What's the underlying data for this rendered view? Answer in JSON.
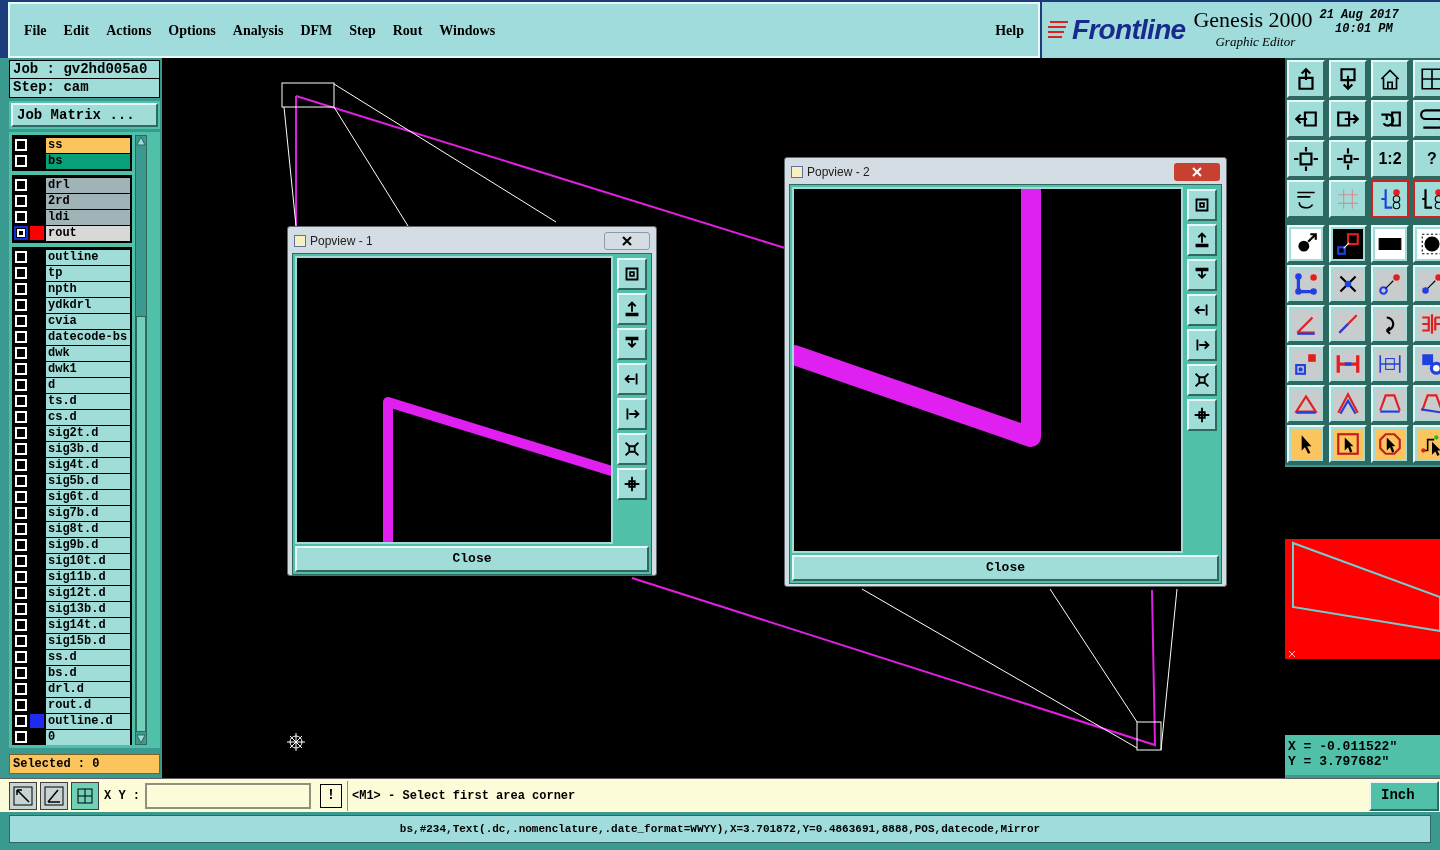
{
  "menu": [
    {
      "label": "File"
    },
    {
      "label": "Edit"
    },
    {
      "label": "Actions"
    },
    {
      "label": "Options"
    },
    {
      "label": "Analysis"
    },
    {
      "label": "DFM"
    },
    {
      "label": "Step"
    },
    {
      "label": "Rout"
    },
    {
      "label": "Windows"
    }
  ],
  "help": "Help",
  "brand": {
    "logo": "Frontline",
    "product": "Genesis 2000",
    "subtitle": "Graphic Editor",
    "date": "21 Aug 2017",
    "time": "10:01 PM"
  },
  "job": "Job : gv2hd005a0",
  "step": "Step: cam",
  "job_matrix_button": "Job Matrix ...",
  "layer_groups": [
    [
      {
        "name": "ss",
        "kind": "silk_screen",
        "selected": false
      },
      {
        "name": "bs",
        "kind": "solder_mask",
        "selected": false
      }
    ],
    [
      {
        "name": "drl",
        "kind": "drill",
        "selected": false
      },
      {
        "name": "2rd",
        "kind": "drill",
        "selected": false
      },
      {
        "name": "ldi",
        "kind": "drill",
        "selected": false
      },
      {
        "name": "rout",
        "kind": "rout",
        "color": "#ff0000",
        "selected": true
      }
    ],
    [
      {
        "name": "outline",
        "kind": "document",
        "selected": false
      },
      {
        "name": "tp",
        "kind": "document",
        "selected": false
      },
      {
        "name": "npth",
        "kind": "document",
        "selected": false
      },
      {
        "name": "ydkdrl",
        "kind": "document",
        "selected": false
      },
      {
        "name": "cvia",
        "kind": "document",
        "selected": false
      },
      {
        "name": "datecode-bs",
        "kind": "document",
        "selected": false
      },
      {
        "name": "dwk",
        "kind": "document",
        "selected": false
      },
      {
        "name": "dwk1",
        "kind": "document",
        "selected": false
      },
      {
        "name": "d",
        "kind": "document",
        "selected": false
      },
      {
        "name": "ts.d",
        "kind": "document",
        "selected": false
      },
      {
        "name": "cs.d",
        "kind": "document",
        "selected": false
      },
      {
        "name": "sig2t.d",
        "kind": "document",
        "selected": false
      },
      {
        "name": "sig3b.d",
        "kind": "document",
        "selected": false
      },
      {
        "name": "sig4t.d",
        "kind": "document",
        "selected": false
      },
      {
        "name": "sig5b.d",
        "kind": "document",
        "selected": false
      },
      {
        "name": "sig6t.d",
        "kind": "document",
        "selected": false
      },
      {
        "name": "sig7b.d",
        "kind": "document",
        "selected": false
      },
      {
        "name": "sig8t.d",
        "kind": "document",
        "selected": false
      },
      {
        "name": "sig9b.d",
        "kind": "document",
        "selected": false
      },
      {
        "name": "sig10t.d",
        "kind": "document",
        "selected": false
      },
      {
        "name": "sig11b.d",
        "kind": "document",
        "selected": false
      },
      {
        "name": "sig12t.d",
        "kind": "document",
        "selected": false
      },
      {
        "name": "sig13b.d",
        "kind": "document",
        "selected": false
      },
      {
        "name": "sig14t.d",
        "kind": "document",
        "selected": false
      },
      {
        "name": "sig15b.d",
        "kind": "document",
        "selected": false
      },
      {
        "name": "ss.d",
        "kind": "document",
        "selected": false
      },
      {
        "name": "bs.d",
        "kind": "document",
        "selected": false
      },
      {
        "name": "drl.d",
        "kind": "document",
        "selected": false
      },
      {
        "name": "rout.d",
        "kind": "document",
        "selected": false
      },
      {
        "name": "outline.d",
        "kind": "document",
        "color": "#1f2cf0",
        "selected": false
      },
      {
        "name": "0",
        "kind": "document",
        "selected": false
      }
    ]
  ],
  "selected_count": "Selected : 0",
  "popviews": [
    {
      "title": "Popview - 1",
      "close_button": "Close"
    },
    {
      "title": "Popview - 2",
      "close_button": "Close"
    }
  ],
  "toolbar_labels": [
    "1:2",
    "?"
  ],
  "coordinates": {
    "x": "X = -0.011522\"",
    "y": "Y = 3.797682\""
  },
  "command_bar": {
    "xy_label": "X Y :",
    "alert_button": "!",
    "prompt": "<M1> - Select first area corner",
    "units": "Inch"
  },
  "status_line": "bs,#234,Text(.dc,.nomenclature,.date_format=WWYY),X=3.701872,Y=0.4863691,8888,POS,datecode,Mirror"
}
